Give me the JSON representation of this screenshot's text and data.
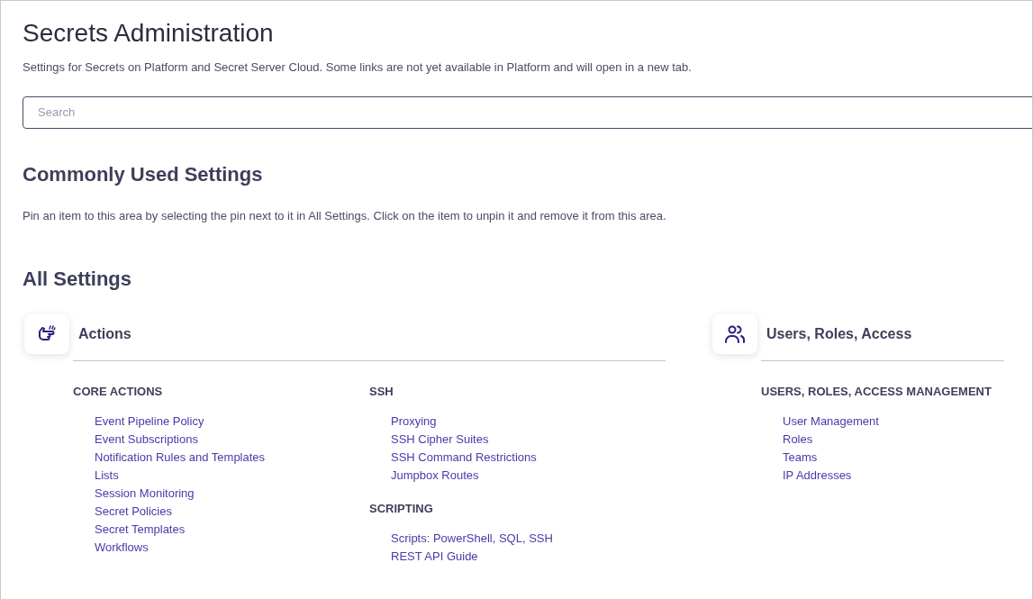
{
  "header": {
    "title": "Secrets Administration",
    "subtitle": "Settings for Secrets on Platform and Secret Server Cloud. Some links are not yet available in Platform and will open in a new tab."
  },
  "search": {
    "placeholder": "Search"
  },
  "common": {
    "title": "Commonly Used Settings",
    "hint": "Pin an item to this area by selecting the pin next to it in All Settings. Click on the item to unpin it and remove it from this area."
  },
  "all_settings": {
    "title": "All Settings",
    "categories": [
      {
        "title": "Actions",
        "kind": "actions",
        "columns": [
          [
            {
              "heading": "CORE ACTIONS",
              "links": [
                "Event Pipeline Policy",
                "Event Subscriptions",
                "Notification Rules and Templates",
                "Lists",
                "Session Monitoring",
                "Secret Policies",
                "Secret Templates",
                "Workflows"
              ]
            }
          ],
          [
            {
              "heading": "SSH",
              "links": [
                "Proxying",
                "SSH Cipher Suites",
                "SSH Command Restrictions",
                "Jumpbox Routes"
              ]
            },
            {
              "heading": "SCRIPTING",
              "links": [
                "Scripts: PowerShell, SQL, SSH",
                "REST API Guide"
              ]
            }
          ]
        ]
      },
      {
        "title": "Users, Roles, Access",
        "kind": "users",
        "columns": [
          [
            {
              "heading": "USERS, ROLES, ACCESS MANAGEMENT",
              "links": [
                "User Management",
                "Roles",
                "Teams",
                "IP Addresses"
              ]
            }
          ]
        ]
      }
    ]
  }
}
